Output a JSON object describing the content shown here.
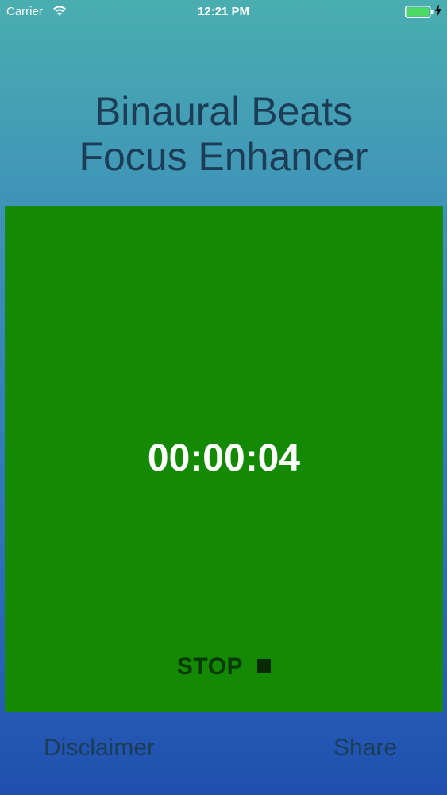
{
  "status_bar": {
    "carrier": "Carrier",
    "time": "12:21 PM",
    "wifi_icon": "wifi-icon",
    "battery_icon": "battery-icon",
    "charging_icon": "charging-bolt-icon",
    "battery_level": 1.0
  },
  "header": {
    "title_line1": "Binaural Beats",
    "title_line2": "Focus Enhancer"
  },
  "player": {
    "elapsed": "00:00:04",
    "stop_label": "STOP",
    "stop_icon": "stop-square-icon"
  },
  "footer": {
    "disclaimer_label": "Disclaimer",
    "share_label": "Share"
  },
  "colors": {
    "panel": "#148a04",
    "title_text": "#1d3d57",
    "battery_fill": "#4cd964"
  }
}
